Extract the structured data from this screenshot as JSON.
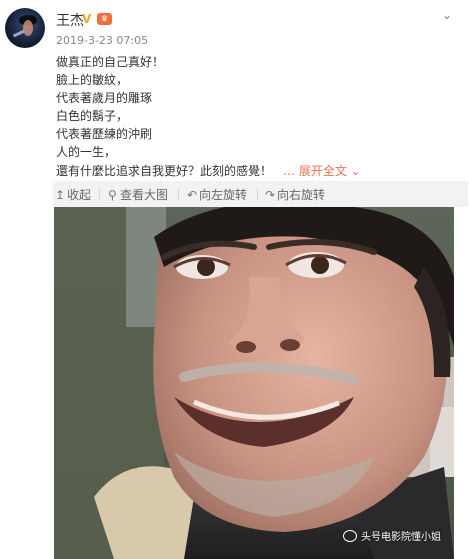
{
  "post": {
    "author": "王杰",
    "verified_badge": "V",
    "member_badge": "♛",
    "timestamp": "2019-3-23 07:05",
    "lines": [
      "做真正的自己真好！",
      "臉上的皺紋，",
      "代表著歲月的雕琢",
      "白色的鬍子，",
      "代表著歷練的沖刷",
      "人的一生，",
      "還有什麼比追求自我更好？此刻的感覺！"
    ],
    "expand_label": "… 展开全文 ⌄"
  },
  "toolbar": {
    "collapse_label": "收起",
    "view_large_label": "查看大图",
    "rotate_left_label": "向左旋转",
    "rotate_right_label": "向右旋转"
  },
  "watermark": {
    "text": "头号电影院懂小姐"
  },
  "colors": {
    "link_accent": "#eb7350",
    "verified": "#f5a623",
    "toolbar_bg": "#f2f2f2"
  },
  "icons": {
    "collapse": "arrow-up-icon",
    "view_large": "magnifier-icon",
    "rotate_left": "rotate-left-icon",
    "rotate_right": "rotate-right-icon",
    "menu": "chevron-down-icon"
  }
}
